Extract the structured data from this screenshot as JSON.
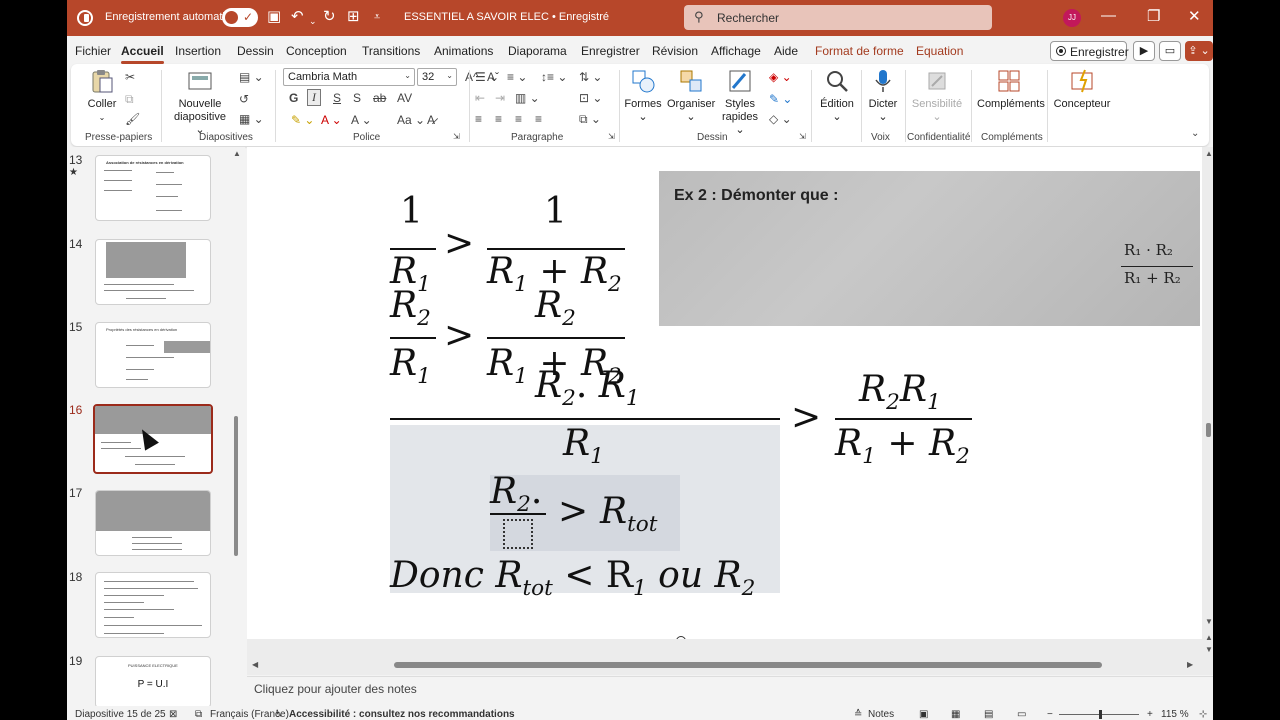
{
  "titlebar": {
    "autosave_label": "Enregistrement automatique",
    "document_title": "ESSENTIEL A SAVOIR  ELEC  •  Enregistré",
    "search_placeholder": "Rechercher",
    "user_initials": "JJ"
  },
  "menu": {
    "tabs": [
      "Fichier",
      "Accueil",
      "Insertion",
      "Dessin",
      "Conception",
      "Transitions",
      "Animations",
      "Diaporama",
      "Enregistrer",
      "Révision",
      "Affichage",
      "Aide",
      "Format de forme",
      "Equation"
    ],
    "active_tab": "Accueil",
    "record_button": "Enregistrer"
  },
  "ribbon": {
    "groups": {
      "clipboard": "Presse-papiers",
      "slides": "Diapositives",
      "font": "Police",
      "paragraph": "Paragraphe",
      "drawing": "Dessin",
      "voice": "Voix",
      "confidentiality": "Confidentialité",
      "addins": "Compléments"
    },
    "buttons": {
      "paste": "Coller",
      "new_slide_1": "Nouvelle",
      "new_slide_2": "diapositive",
      "shapes": "Formes",
      "arrange": "Organiser",
      "quick_styles_1": "Styles",
      "quick_styles_2": "rapides",
      "editing": "Édition",
      "dictate": "Dicter",
      "sensitivity": "Sensibilité",
      "addins": "Compléments",
      "designer": "Concepteur"
    },
    "font_name": "Cambria Math",
    "font_size": "32",
    "bold": "G",
    "italic": "I",
    "underline": "S",
    "strike": "ab",
    "case": "AV"
  },
  "thumbnails": [
    {
      "number": "13",
      "title": "Association de résistances en dérivation",
      "starred": true
    },
    {
      "number": "14",
      "title": ""
    },
    {
      "number": "15",
      "title": "Propriétés des résistances en dérivation"
    },
    {
      "number": "16",
      "title": "",
      "selected": true
    },
    {
      "number": "17",
      "title": ""
    },
    {
      "number": "18",
      "title": ""
    },
    {
      "number": "19",
      "title": "PUISSANCE ELECTRIQUE",
      "formula": "P = U.I"
    }
  ],
  "slide": {
    "photo_title": "Ex 2 : Démonter que :",
    "photo_num": "R₁ · R₂",
    "photo_den": "R₁ + R₂",
    "eq1_lhs_num": "1",
    "eq1_lhs_den": "R",
    "eq1_rhs_num": "1",
    "eq1_rhs_den": "R",
    "eq2_lhs_num": "R",
    "eq2_lhs_den": "R",
    "eq2_rhs_num": "R",
    "eq2_rhs_den": "R",
    "eq3_lhs_num": "R",
    "eq3_lhs_den": "R",
    "eq3_rhs_num": "R",
    "eq3_rhs_den": "R",
    "eq4_num": "R",
    "eq4_rhs": "R",
    "eq5_text": "Donc R",
    "eq5_rest": "< R",
    "eq5_or": "ou R",
    "sub_one": "1",
    "sub_two": "2",
    "sub_tot": "tot",
    "gt": ">",
    "plus": "+"
  },
  "notes_placeholder": "Cliquez pour ajouter des notes",
  "status": {
    "slide_info": "Diapositive 15 de 25",
    "language": "Français (France)",
    "accessibility": "Accessibilité : consultez nos recommandations",
    "notes": "Notes",
    "zoom": "115 %"
  }
}
